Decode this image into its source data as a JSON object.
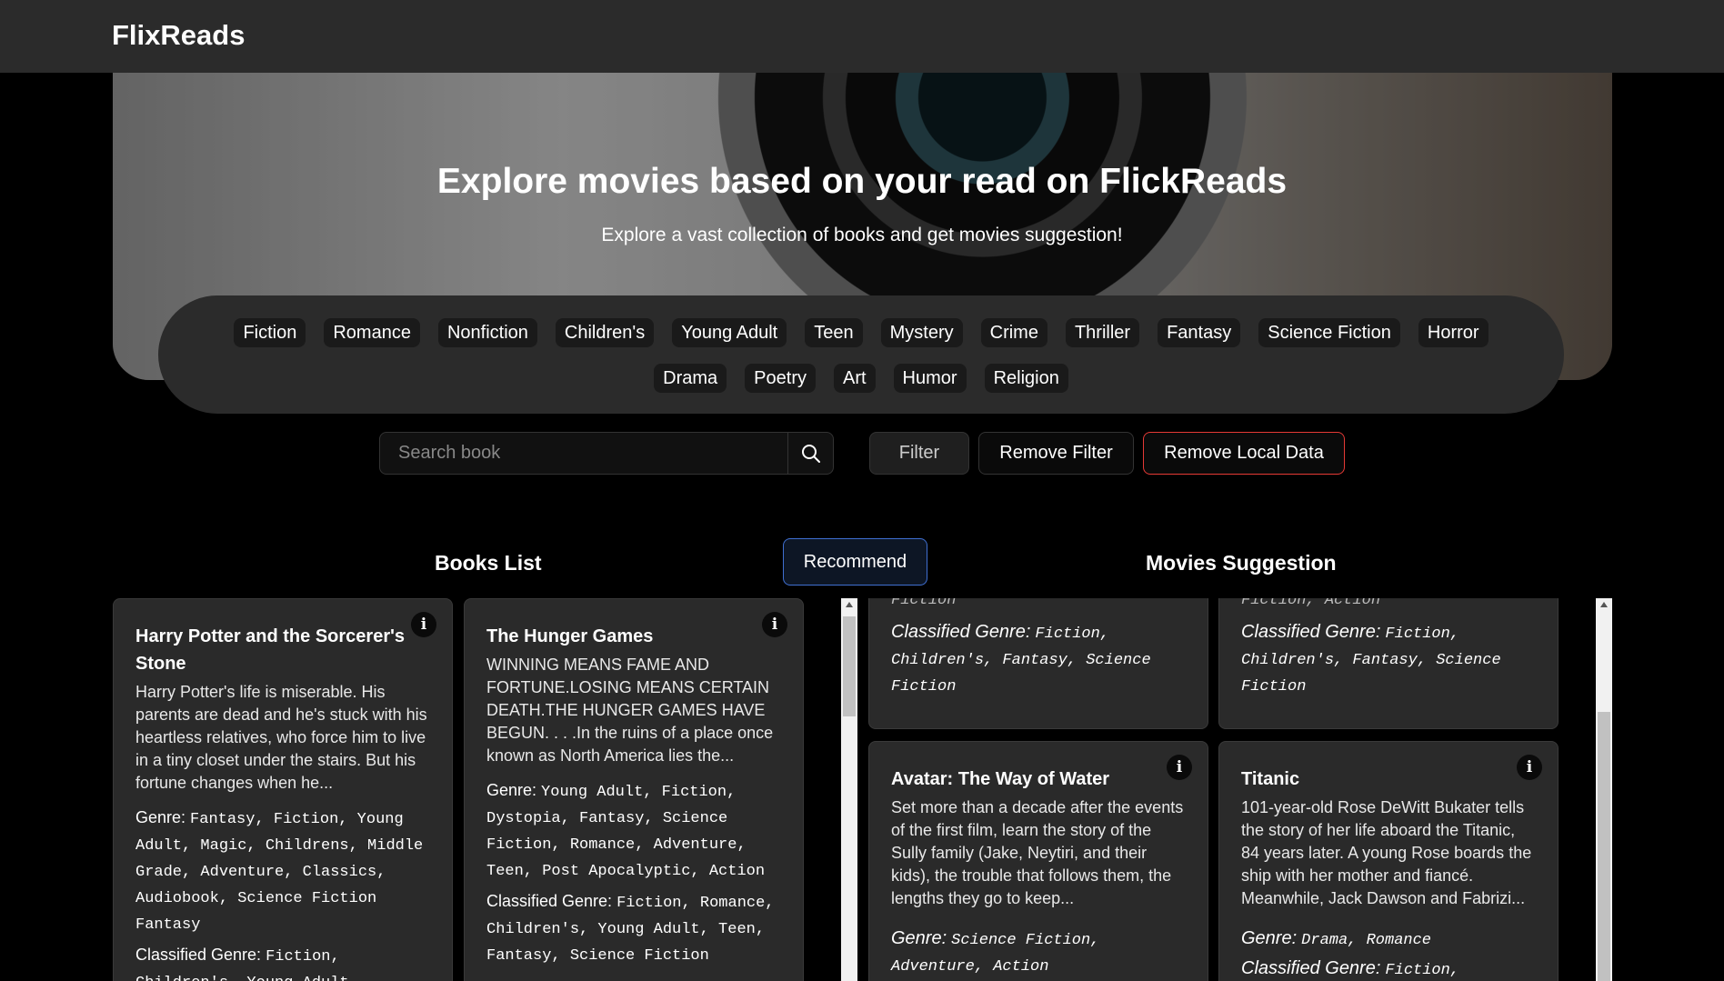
{
  "nav": {
    "brand": "FlixReads"
  },
  "hero": {
    "title": "Explore movies based on your read on FlickReads",
    "subtitle": "Explore a vast collection of books and get movies suggestion!"
  },
  "genres": [
    "Fiction",
    "Romance",
    "Nonfiction",
    "Children's",
    "Young Adult",
    "Teen",
    "Mystery",
    "Crime",
    "Thriller",
    "Fantasy",
    "Science Fiction",
    "Horror",
    "Drama",
    "Poetry",
    "Art",
    "Humor",
    "Religion"
  ],
  "search": {
    "placeholder": "Search book",
    "value": ""
  },
  "buttons": {
    "filter": "Filter",
    "remove_filter": "Remove Filter",
    "remove_local": "Remove Local Data",
    "recommend": "Recommend"
  },
  "sections": {
    "books": "Books List",
    "movies": "Movies Suggestion"
  },
  "labels": {
    "genre": "Genre:",
    "classified": "Classified Genre:",
    "info": "i"
  },
  "books": [
    {
      "title": "Harry Potter and the Sorcerer's Stone",
      "description": "Harry Potter's life is miserable. His parents are dead and he's stuck with his heartless relatives, who force him to live in a tiny closet under the stairs. But his fortune changes when he...",
      "genre": "Fantasy, Fiction, Young Adult, Magic, Childrens, Middle Grade, Adventure, Classics, Audiobook, Science Fiction Fantasy",
      "classified": "Fiction, Children's, Young Adult, Fantasy"
    },
    {
      "title": "The Hunger Games",
      "description": "WINNING MEANS FAME AND FORTUNE.LOSING MEANS CERTAIN DEATH.THE HUNGER GAMES HAVE BEGUN. . . .In the ruins of a place once known as North America lies the...",
      "genre": "Young Adult, Fiction, Dystopia, Fantasy, Science Fiction, Romance, Adventure, Teen, Post Apocalyptic, Action",
      "classified": "Fiction, Romance, Children's, Young Adult, Teen, Fantasy, Science Fiction"
    }
  ],
  "movies": [
    {
      "genre_tail": "Fiction",
      "classified": "Fiction, Children's, Fantasy, Science Fiction"
    },
    {
      "genre_tail": "Fiction, Action",
      "classified": "Fiction, Children's, Fantasy, Science Fiction"
    },
    {
      "title": "Avatar: The Way of Water",
      "description": "Set more than a decade after the events of the first film, learn the story of the Sully family (Jake, Neytiri, and their kids), the trouble that follows them, the lengths they go to keep...",
      "genre": "Science Fiction, Adventure, Action"
    },
    {
      "title": "Titanic",
      "description": "101-year-old Rose DeWitt Bukater tells the story of her life aboard the Titanic, 84 years later. A young Rose boards the ship with her mother and fiancé. Meanwhile, Jack Dawson and Fabrizi...",
      "genre": "Drama, Romance",
      "classified": "Fiction,"
    }
  ]
}
